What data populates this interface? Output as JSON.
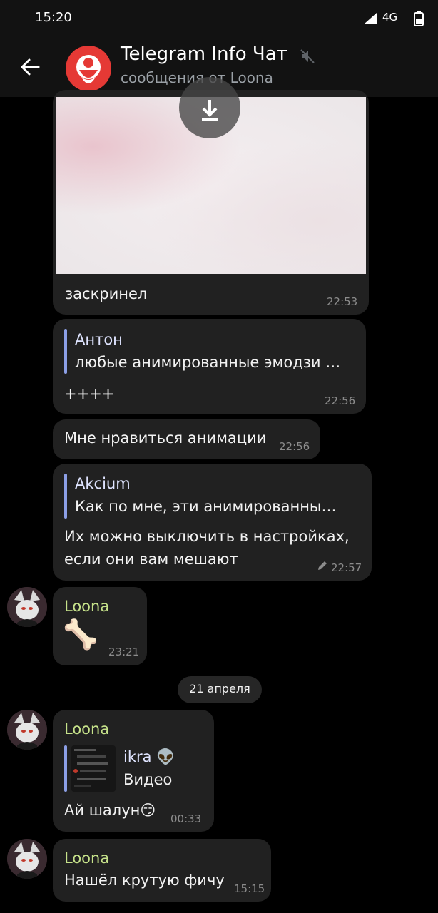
{
  "status_bar": {
    "time": "15:20",
    "network": "4G"
  },
  "header": {
    "title": "Telegram Info Чат",
    "subtitle": "сообщения от Loona"
  },
  "messages": [
    {
      "text": "заскринел",
      "time": "22:53"
    },
    {
      "reply_name": "Антон",
      "reply_text": "любые анимированные эмодзи …",
      "text": "++++",
      "time": "22:56"
    },
    {
      "text": "Мне нравиться анимации",
      "time": "22:56"
    },
    {
      "reply_name": "Akcium",
      "reply_text": "Как по мне, эти анимированны…",
      "text_line1": "Их можно выключить в настройках,",
      "text_line2": "если они вам мешают",
      "time": "22:57"
    },
    {
      "sender": "Loona",
      "emoji": "🦴",
      "time": "23:21"
    }
  ],
  "date_separator": "21 апреля",
  "messages_after": [
    {
      "sender": "Loona",
      "reply_name": "ikra 👽",
      "reply_text": "Видео",
      "text": "Ай шалун😏",
      "time": "00:33"
    },
    {
      "sender": "Loona",
      "text": "Нашёл крутую фичу",
      "time": "15:15"
    }
  ],
  "colors": {
    "accent_name": "#c6e28a",
    "reply_bar": "#8c9fe6",
    "bubble": "#212121",
    "background": "#000000"
  }
}
